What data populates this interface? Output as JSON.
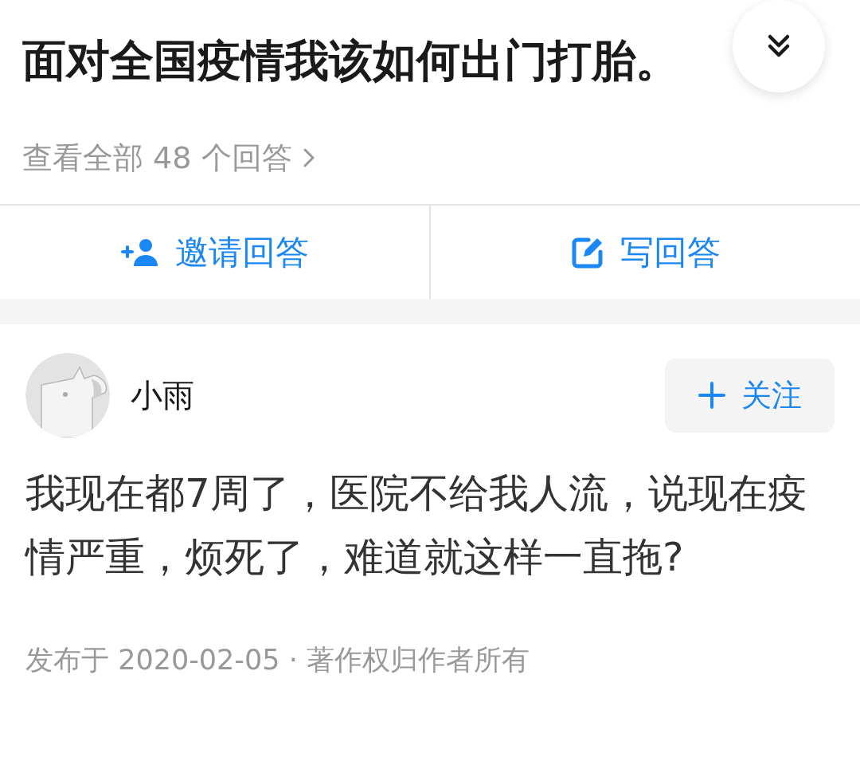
{
  "question": {
    "title": "面对全国疫情我该如何出门打胎。",
    "view_all": "查看全部 48 个回答"
  },
  "actions": [
    {
      "kind": "invite",
      "label": "邀请回答"
    },
    {
      "kind": "write",
      "label": "写回答"
    }
  ],
  "answer": {
    "author": "小雨",
    "follow_label": "关注",
    "body": "我现在都7周了，医院不给我人流，说现在疫情严重，烦死了，难道就这样一直拖?",
    "meta": "发布于 2020-02-05 · 著作权归作者所有"
  }
}
